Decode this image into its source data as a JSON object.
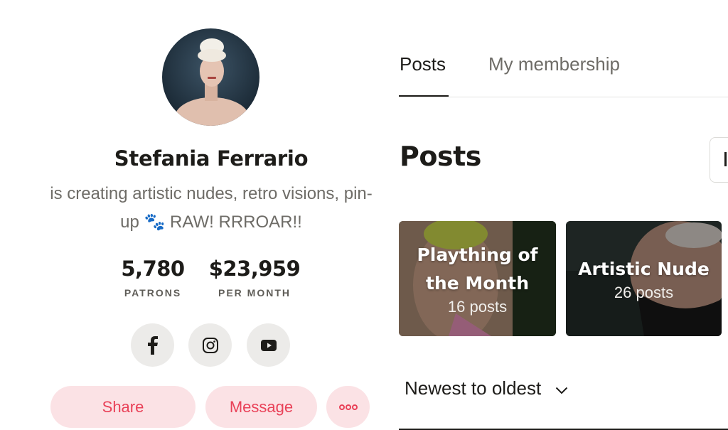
{
  "profile": {
    "name": "Stefania Ferrario",
    "tagline": "is creating artistic nudes, retro visions, pin-up 🐾 RAW! RRROAR!!",
    "avatar_icon": "avatar",
    "stats": {
      "patrons_value": "5,780",
      "patrons_label": "PATRONS",
      "earnings_value": "$23,959",
      "earnings_label": "PER MONTH"
    },
    "social": [
      "facebook-icon",
      "instagram-icon",
      "youtube-icon"
    ],
    "actions": {
      "share_label": "Share",
      "message_label": "Message",
      "more_icon": "more-icon"
    }
  },
  "tabs": [
    {
      "label": "Posts",
      "active": true
    },
    {
      "label": "My membership",
      "active": false
    }
  ],
  "posts_section": {
    "title": "Posts",
    "collections": [
      {
        "title": "Plaything of the Month",
        "count": "16 posts"
      },
      {
        "title": "Artistic Nude",
        "count": "26 posts"
      }
    ],
    "sort_label": "Newest to oldest"
  },
  "colors": {
    "accent": "#e94158",
    "button_bg": "#fbe2e5",
    "text": "#1d1c19",
    "muted": "#6e6c67"
  }
}
